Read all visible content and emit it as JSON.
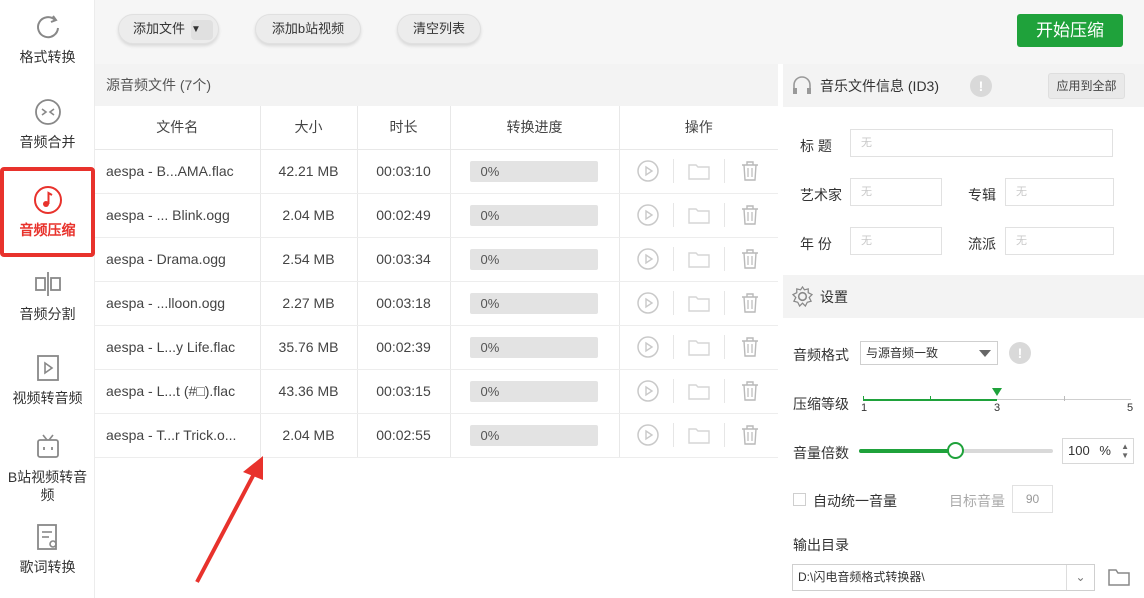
{
  "sidebar": {
    "items": [
      {
        "label": "格式转换",
        "icon": "refresh-icon"
      },
      {
        "label": "音频合并",
        "icon": "merge-icon"
      },
      {
        "label": "音频压缩",
        "icon": "music-note-icon"
      },
      {
        "label": "音频分割",
        "icon": "split-icon"
      },
      {
        "label": "视频转音频",
        "icon": "video-icon"
      },
      {
        "label": "B站视频转音频",
        "icon": "tv-icon"
      },
      {
        "label": "歌词转换",
        "icon": "lyrics-icon"
      }
    ]
  },
  "toolbar": {
    "add_file": "添加文件",
    "add_bilibili": "添加b站视频",
    "clear_list": "清空列表",
    "start": "开始压缩",
    "start_color": "#1fa23b"
  },
  "files": {
    "header": "源音频文件 (7个)",
    "columns": [
      "文件名",
      "大小",
      "时长",
      "转换进度",
      "操作"
    ],
    "rows": [
      {
        "name": "aespa - B...AMA.flac",
        "size": "42.21 MB",
        "duration": "00:03:10",
        "progress": "0%"
      },
      {
        "name": "aespa - ... Blink.ogg",
        "size": "2.04 MB",
        "duration": "00:02:49",
        "progress": "0%"
      },
      {
        "name": "aespa - Drama.ogg",
        "size": "2.54 MB",
        "duration": "00:03:34",
        "progress": "0%"
      },
      {
        "name": "aespa - ...lloon.ogg",
        "size": "2.27 MB",
        "duration": "00:03:18",
        "progress": "0%"
      },
      {
        "name": "aespa - L...y Life.flac",
        "size": "35.76 MB",
        "duration": "00:02:39",
        "progress": "0%"
      },
      {
        "name": "aespa - L...t (#□).flac",
        "size": "43.36 MB",
        "duration": "00:03:15",
        "progress": "0%"
      },
      {
        "name": "aespa - T...r Trick.o...",
        "size": "2.04 MB",
        "duration": "00:02:55",
        "progress": "0%"
      }
    ]
  },
  "id3": {
    "title": "音乐文件信息 (ID3)",
    "apply_all": "应用到全部",
    "labels": {
      "title": "标 题",
      "artist": "艺术家",
      "album": "专辑",
      "year": "年 份",
      "genre": "流派"
    },
    "placeholder": "无"
  },
  "settings": {
    "title": "设置",
    "format_label": "音频格式",
    "format_value": "与源音频一致",
    "level_label": "压缩等级",
    "level_min": "1",
    "level_value": "3",
    "level_max": "5",
    "volume_label": "音量倍数",
    "volume_fraction": 0.5,
    "volume_value": "100",
    "volume_unit": "%",
    "auto_volume_label": "自动统一音量",
    "target_label": "目标音量",
    "target_value": "90",
    "output_label": "输出目录",
    "output_path": "D:\\闪电音频格式转换器\\"
  },
  "colors": {
    "accent_red": "#e8322c",
    "green": "#1fa23b"
  }
}
